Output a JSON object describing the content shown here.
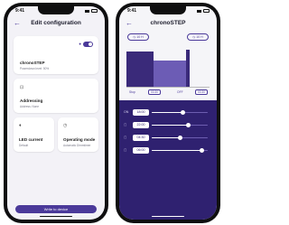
{
  "left": {
    "status_time": "9:41",
    "title": "Edit configuration",
    "device_card": {
      "name": "chronoSTEP",
      "sub": "Powerdown level: 50%"
    },
    "addressing_card": {
      "title": "Addressing",
      "sub": "Address: None"
    },
    "led_card": {
      "title": "LED current",
      "sub": "Default"
    },
    "mode_card": {
      "title": "Operating mode",
      "sub": "Automatic Dimmtimer"
    },
    "write_button": "Write to device"
  },
  "right": {
    "status_time": "9:41",
    "title": "chronoSTEP",
    "pill_left": "◷ 10 H",
    "pill_right": "◷ 10 H",
    "stop_label": "Stop",
    "stop_value": "00:30",
    "off_label": "OFF",
    "off_value": "00:30",
    "rows": [
      {
        "label": "ON",
        "time": "18:00",
        "level": 0.55
      },
      {
        "label": "▢",
        "time": "22:00",
        "level": 0.65
      },
      {
        "label": "▢",
        "time": "04:30",
        "level": 0.5
      },
      {
        "label": "▢",
        "time": "06:00",
        "level": 0.9
      }
    ]
  },
  "colors": {
    "accent": "#4b3a9a",
    "panel": "#2f2170"
  }
}
